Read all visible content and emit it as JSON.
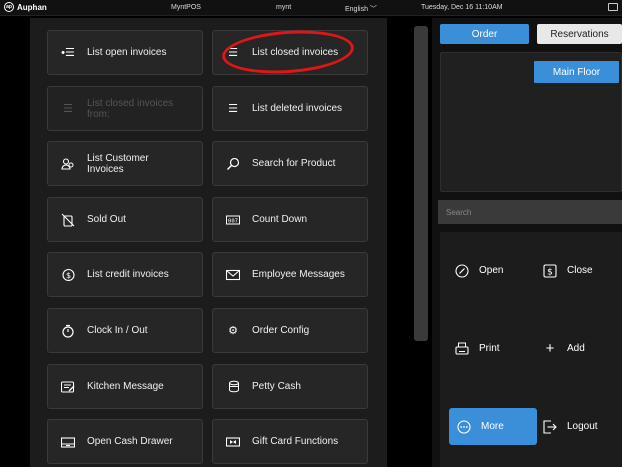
{
  "topbar": {
    "brand": "Auphan",
    "app": "MyntPOS",
    "user": "mynt",
    "language": "English",
    "datetime": "Tuesday, Dec 16 11:10AM"
  },
  "menu": {
    "list_open_invoices": "List open invoices",
    "list_closed_invoices": "List closed invoices",
    "list_closed_invoices_from": "List closed invoices from:",
    "list_deleted_invoices": "List deleted invoices",
    "list_customer_invoices": "List Customer Invoices",
    "search_for_product": "Search for Product",
    "sold_out": "Sold Out",
    "count_down": "Count Down",
    "list_credit_invoices": "List credit invoices",
    "employee_messages": "Employee Messages",
    "clock_in_out": "Clock In / Out",
    "order_config": "Order Config",
    "kitchen_message": "Kitchen Message",
    "petty_cash": "Petty Cash",
    "open_cash_drawer": "Open Cash Drawer",
    "gift_card_functions": "Gift Card Functions"
  },
  "tabs": {
    "order": "Order",
    "reservations": "Reservations"
  },
  "floor": {
    "main_floor": "Main Floor"
  },
  "search": {
    "placeholder": "Search"
  },
  "actions": {
    "open": "Open",
    "close": "Close",
    "print": "Print",
    "add": "Add",
    "more": "More",
    "logout": "Logout"
  },
  "colors": {
    "accent": "#3b8fd9",
    "annotation": "#e01616"
  }
}
